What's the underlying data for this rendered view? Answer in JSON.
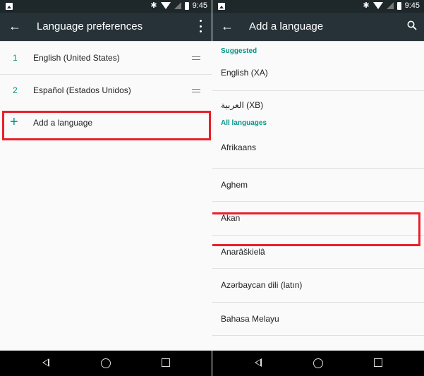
{
  "status_bar": {
    "time": "9:45",
    "icons": [
      "image-icon",
      "bluetooth-icon",
      "wifi-icon",
      "signal-icon",
      "battery-icon"
    ]
  },
  "left_screen": {
    "toolbar": {
      "title": "Language preferences",
      "back_icon": "arrow-left-icon",
      "menu_icon": "more-vert-icon"
    },
    "preferences": [
      {
        "rank": "1",
        "label": "English (United States)"
      },
      {
        "rank": "2",
        "label": "Español (Estados Unidos)"
      }
    ],
    "add_language": {
      "icon": "+",
      "label": "Add a language"
    }
  },
  "right_screen": {
    "toolbar": {
      "title": "Add a language",
      "back_icon": "arrow-left-icon",
      "search_icon": "search-icon"
    },
    "suggested_header": "Suggested",
    "suggested": [
      {
        "label": "English (XA)"
      },
      {
        "label": "العربية (XB)"
      }
    ],
    "all_header": "All languages",
    "all_languages": [
      {
        "label": "Afrikaans"
      },
      {
        "label": "Aghem"
      },
      {
        "label": "Akan"
      },
      {
        "label": "Anarâškielâ"
      },
      {
        "label": "Azərbaycan dili (latın)"
      },
      {
        "label": "Bahasa Melayu"
      }
    ]
  },
  "colors": {
    "accent": "#009688",
    "toolbar": "#263238",
    "statusbar": "#1e272a",
    "highlight": "#e8202a"
  }
}
